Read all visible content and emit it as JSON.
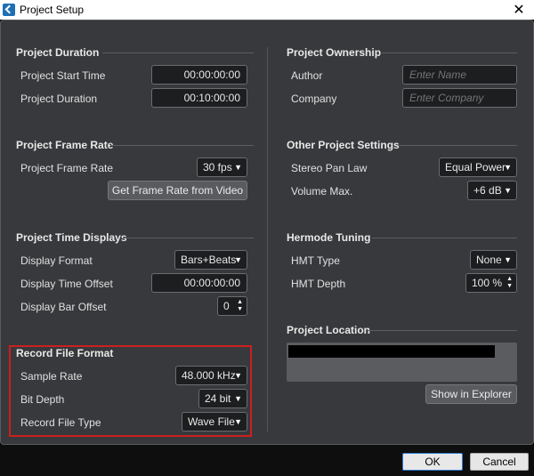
{
  "window": {
    "title": "Project Setup",
    "close_glyph": "✕"
  },
  "sections": {
    "duration": {
      "title": "Project Duration",
      "start_label": "Project Start Time",
      "start_value": "00:00:00:00",
      "duration_label": "Project Duration",
      "duration_value": "00:10:00:00"
    },
    "frame_rate": {
      "title": "Project Frame Rate",
      "label": "Project Frame Rate",
      "value": "30 fps",
      "button": "Get Frame Rate from Video"
    },
    "time_displays": {
      "title": "Project Time Displays",
      "format_label": "Display Format",
      "format_value": "Bars+Beats",
      "offset_label": "Display Time Offset",
      "offset_value": "00:00:00:00",
      "bar_offset_label": "Display Bar Offset",
      "bar_offset_value": "0"
    },
    "record_format": {
      "title": "Record File Format",
      "rate_label": "Sample Rate",
      "rate_value": "48.000 kHz",
      "depth_label": "Bit Depth",
      "depth_value": "24 bit",
      "type_label": "Record File Type",
      "type_value": "Wave File"
    },
    "ownership": {
      "title": "Project Ownership",
      "author_label": "Author",
      "author_placeholder": "Enter Name",
      "company_label": "Company",
      "company_placeholder": "Enter Company"
    },
    "other": {
      "title": "Other Project Settings",
      "pan_label": "Stereo Pan Law",
      "pan_value": "Equal Power",
      "volume_label": "Volume Max.",
      "volume_value": "+6 dB"
    },
    "hermode": {
      "title": "Hermode Tuning",
      "type_label": "HMT Type",
      "type_value": "None",
      "depth_label": "HMT Depth",
      "depth_value": "100 %"
    },
    "location": {
      "title": "Project Location",
      "button": "Show in Explorer"
    }
  },
  "footer": {
    "ok": "OK",
    "cancel": "Cancel"
  },
  "glyphs": {
    "dropdown": "▼",
    "spin": "▲\n▼"
  },
  "colors": {
    "panel": "#38393c",
    "highlight": "#cc1f1f",
    "ok_border": "#2f7ad1"
  }
}
